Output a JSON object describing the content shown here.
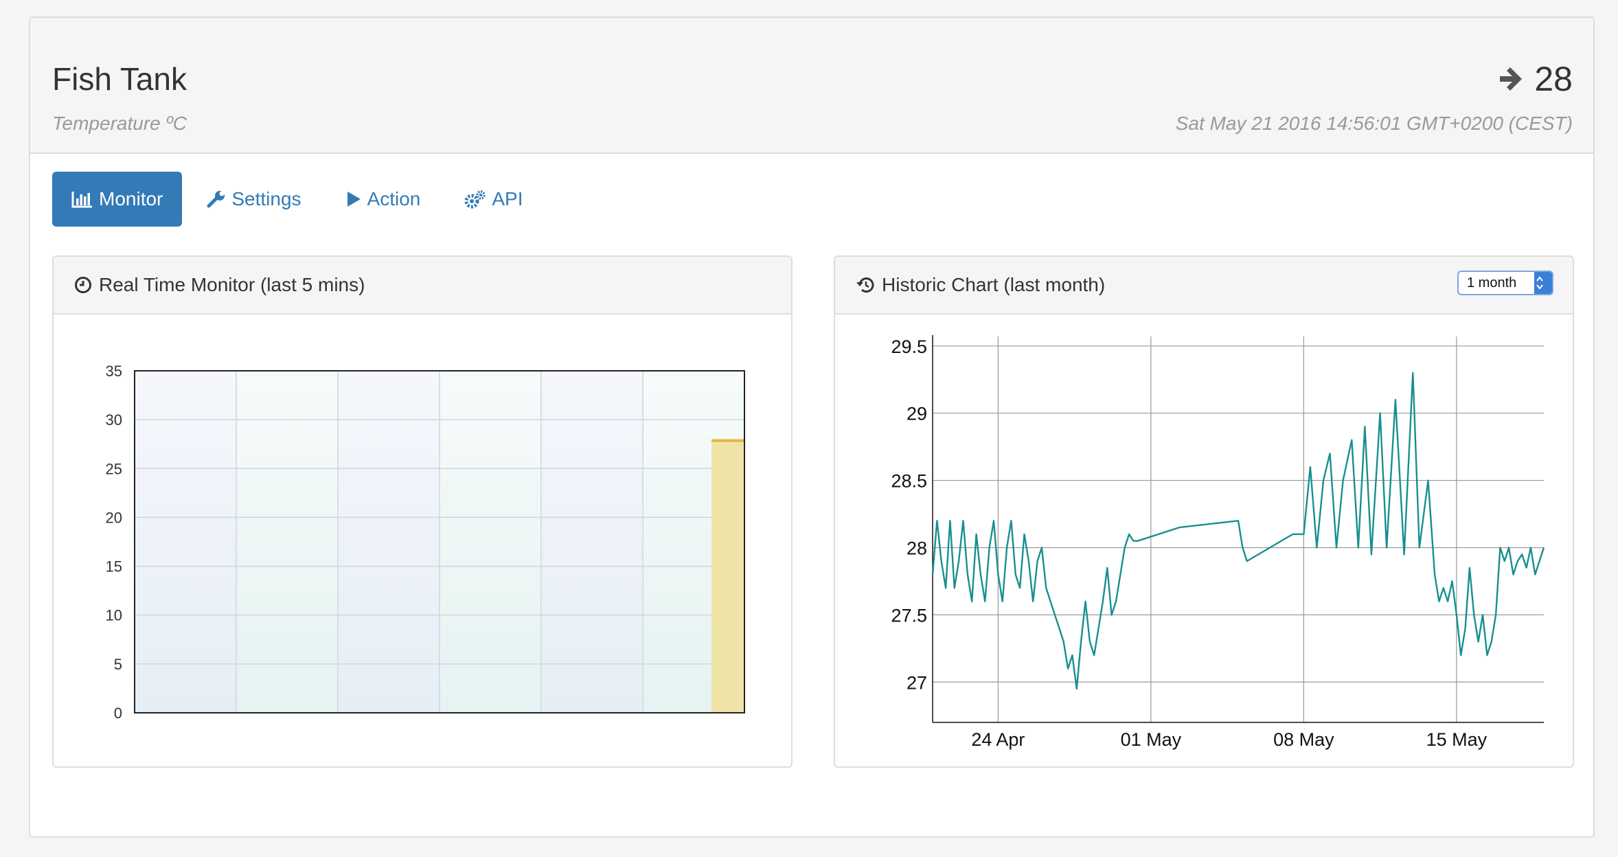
{
  "header": {
    "title": "Fish Tank",
    "subtitle": "Temperature ºC",
    "value": "28",
    "value_icon": "arrow-right-icon",
    "timestamp": "Sat May 21 2016 14:56:01 GMT+0200 (CEST)"
  },
  "tabs": [
    {
      "label": "Monitor",
      "icon": "bar-chart-icon",
      "active": true
    },
    {
      "label": "Settings",
      "icon": "wrench-icon",
      "active": false
    },
    {
      "label": "Action",
      "icon": "play-icon",
      "active": false
    },
    {
      "label": "API",
      "icon": "cogs-icon",
      "active": false
    }
  ],
  "realtime": {
    "title": "Real Time Monitor (last 5 mins)",
    "icon": "clock-icon"
  },
  "historic": {
    "title": "Historic Chart (last month)",
    "icon": "history-icon",
    "range_select": "1 month"
  },
  "colors": {
    "accent": "#337ab7",
    "bar_fill": "#f0e3a8",
    "bar_top": "#e0b640",
    "line": "#178f8f"
  },
  "chart_data": [
    {
      "type": "bar",
      "title": "",
      "yticks": [
        "0",
        "5",
        "10",
        "15",
        "20",
        "25",
        "30",
        "35"
      ],
      "ylim": [
        0,
        35
      ],
      "x_columns": 6,
      "values": [
        28
      ],
      "bar_position": "rightmost",
      "grid": true
    },
    {
      "type": "line",
      "title": "",
      "xticks": [
        "24 Apr",
        "01 May",
        "08 May",
        "15 May"
      ],
      "yticks": [
        "27",
        "27.5",
        "28",
        "28.5",
        "29",
        "29.5"
      ],
      "ylim": [
        26.7,
        29.55
      ],
      "grid": true,
      "points": [
        [
          21.0,
          27.8
        ],
        [
          21.2,
          28.2
        ],
        [
          21.4,
          27.9
        ],
        [
          21.6,
          27.7
        ],
        [
          21.8,
          28.2
        ],
        [
          22.0,
          27.7
        ],
        [
          22.2,
          27.9
        ],
        [
          22.4,
          28.2
        ],
        [
          22.6,
          27.8
        ],
        [
          22.8,
          27.6
        ],
        [
          23.0,
          28.1
        ],
        [
          23.2,
          27.8
        ],
        [
          23.4,
          27.6
        ],
        [
          23.6,
          28.0
        ],
        [
          23.8,
          28.2
        ],
        [
          24.0,
          27.8
        ],
        [
          24.2,
          27.6
        ],
        [
          24.4,
          28.0
        ],
        [
          24.6,
          28.2
        ],
        [
          24.8,
          27.8
        ],
        [
          25.0,
          27.7
        ],
        [
          25.2,
          28.1
        ],
        [
          25.4,
          27.9
        ],
        [
          25.6,
          27.6
        ],
        [
          25.8,
          27.9
        ],
        [
          26.0,
          28.0
        ],
        [
          26.2,
          27.7
        ],
        [
          26.4,
          27.6
        ],
        [
          26.6,
          27.5
        ],
        [
          26.8,
          27.4
        ],
        [
          27.0,
          27.3
        ],
        [
          27.2,
          27.1
        ],
        [
          27.4,
          27.2
        ],
        [
          27.6,
          26.95
        ],
        [
          27.8,
          27.3
        ],
        [
          28.0,
          27.6
        ],
        [
          28.2,
          27.3
        ],
        [
          28.4,
          27.2
        ],
        [
          28.6,
          27.4
        ],
        [
          28.8,
          27.6
        ],
        [
          29.0,
          27.85
        ],
        [
          29.2,
          27.5
        ],
        [
          29.4,
          27.6
        ],
        [
          29.6,
          27.8
        ],
        [
          29.8,
          28.0
        ],
        [
          30.0,
          28.1
        ],
        [
          30.2,
          28.05
        ],
        [
          30.4,
          28.05
        ],
        [
          32.3,
          28.15
        ],
        [
          35.0,
          28.2
        ],
        [
          35.2,
          28.0
        ],
        [
          35.4,
          27.9
        ],
        [
          37.5,
          28.1
        ],
        [
          38.0,
          28.1
        ],
        [
          38.3,
          28.6
        ],
        [
          38.6,
          28.0
        ],
        [
          38.9,
          28.5
        ],
        [
          39.2,
          28.7
        ],
        [
          39.5,
          28.0
        ],
        [
          39.8,
          28.5
        ],
        [
          40.2,
          28.8
        ],
        [
          40.5,
          28.0
        ],
        [
          40.8,
          28.9
        ],
        [
          41.1,
          27.95
        ],
        [
          41.5,
          29.0
        ],
        [
          41.8,
          28.0
        ],
        [
          42.2,
          29.1
        ],
        [
          42.6,
          27.95
        ],
        [
          43.0,
          29.3
        ],
        [
          43.3,
          28.0
        ],
        [
          43.7,
          28.5
        ],
        [
          44.0,
          27.8
        ],
        [
          44.2,
          27.6
        ],
        [
          44.4,
          27.7
        ],
        [
          44.6,
          27.6
        ],
        [
          44.8,
          27.75
        ],
        [
          45.0,
          27.5
        ],
        [
          45.2,
          27.2
        ],
        [
          45.4,
          27.4
        ],
        [
          45.6,
          27.85
        ],
        [
          45.8,
          27.5
        ],
        [
          46.0,
          27.3
        ],
        [
          46.2,
          27.5
        ],
        [
          46.4,
          27.2
        ],
        [
          46.6,
          27.3
        ],
        [
          46.8,
          27.5
        ],
        [
          47.0,
          28.0
        ],
        [
          47.2,
          27.9
        ],
        [
          47.4,
          28.0
        ],
        [
          47.6,
          27.8
        ],
        [
          47.8,
          27.9
        ],
        [
          48.0,
          27.95
        ],
        [
          48.2,
          27.85
        ],
        [
          48.4,
          28.0
        ],
        [
          48.6,
          27.8
        ],
        [
          48.8,
          27.9
        ],
        [
          49.0,
          28.0
        ]
      ]
    }
  ]
}
